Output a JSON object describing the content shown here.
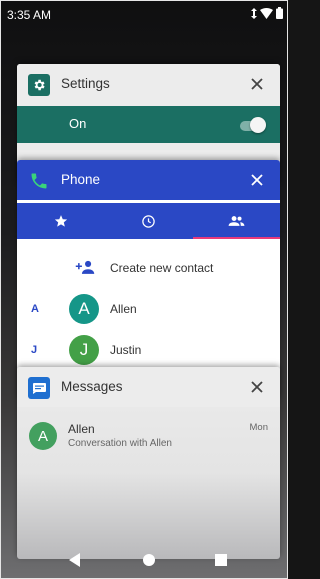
{
  "status_bar": {
    "time": "3:35 AM"
  },
  "settings_card": {
    "title": "Settings",
    "toggle_label": "On",
    "toggle_on": true,
    "accent_color": "#1b6f63"
  },
  "phone_card": {
    "title": "Phone",
    "accent_color": "#2a48c5",
    "tabs": [
      {
        "icon": "star-icon"
      },
      {
        "icon": "clock-icon"
      },
      {
        "icon": "contacts-icon",
        "selected": true
      }
    ],
    "create_contact_label": "Create new contact",
    "contacts": [
      {
        "section": "A",
        "initial": "A",
        "name": "Allen",
        "color": "#159688"
      },
      {
        "section": "J",
        "initial": "J",
        "name": "Justin",
        "color": "#43a047"
      }
    ]
  },
  "messages_card": {
    "title": "Messages",
    "accent_color": "#1f6fd0",
    "conversation": {
      "initial": "A",
      "name": "Allen",
      "subtitle": "Conversation with Allen",
      "time": "Mon"
    }
  }
}
